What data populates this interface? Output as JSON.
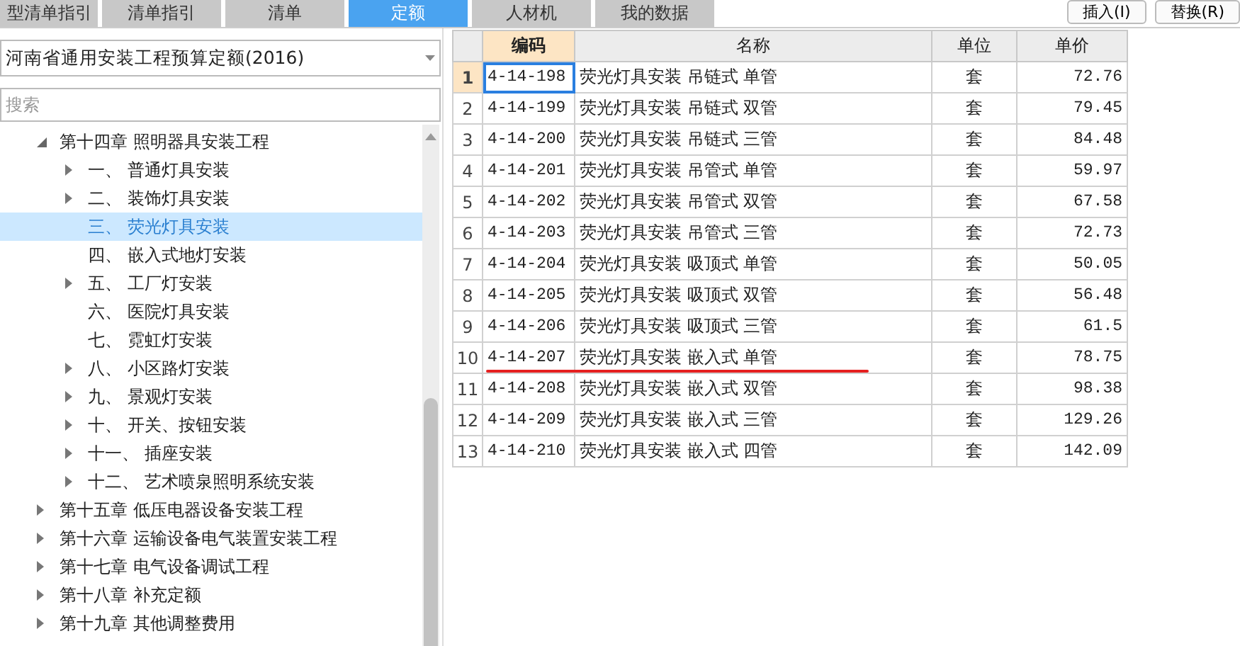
{
  "tabs": [
    {
      "label": "型清单指引",
      "selected": false
    },
    {
      "label": "清单指引",
      "selected": false
    },
    {
      "label": "清单",
      "selected": false
    },
    {
      "label": "定额",
      "selected": true
    },
    {
      "label": "人材机",
      "selected": false
    },
    {
      "label": "我的数据",
      "selected": false
    }
  ],
  "actions": [
    "插入(I)",
    "替换(R)"
  ],
  "library": {
    "value": "河南省通用安装工程预算定额(2016)"
  },
  "search": {
    "placeholder": "搜索"
  },
  "tree": [
    {
      "label": "第十四章 照明器具安装工程",
      "kind": "branch",
      "expanded": true,
      "selected": false,
      "children": [
        {
          "label": "一、 普通灯具安装",
          "kind": "branch",
          "expanded": false,
          "selected": false
        },
        {
          "label": "二、 装饰灯具安装",
          "kind": "branch",
          "expanded": false,
          "selected": false
        },
        {
          "label": "三、 荧光灯具安装",
          "kind": "leaf",
          "expanded": false,
          "selected": true
        },
        {
          "label": "四、 嵌入式地灯安装",
          "kind": "leaf",
          "expanded": false,
          "selected": false
        },
        {
          "label": "五、 工厂灯安装",
          "kind": "branch",
          "expanded": false,
          "selected": false
        },
        {
          "label": "六、 医院灯具安装",
          "kind": "leaf",
          "expanded": false,
          "selected": false
        },
        {
          "label": "七、 霓虹灯安装",
          "kind": "leaf",
          "expanded": false,
          "selected": false
        },
        {
          "label": "八、 小区路灯安装",
          "kind": "branch",
          "expanded": false,
          "selected": false
        },
        {
          "label": "九、 景观灯安装",
          "kind": "branch",
          "expanded": false,
          "selected": false
        },
        {
          "label": "十、 开关、按钮安装",
          "kind": "branch",
          "expanded": false,
          "selected": false
        },
        {
          "label": "十一、 插座安装",
          "kind": "branch",
          "expanded": false,
          "selected": false
        },
        {
          "label": "十二、 艺术喷泉照明系统安装",
          "kind": "branch",
          "expanded": false,
          "selected": false
        }
      ]
    },
    {
      "label": "第十五章 低压电器设备安装工程",
      "kind": "branch",
      "expanded": false,
      "selected": false
    },
    {
      "label": "第十六章 运输设备电气装置安装工程",
      "kind": "branch",
      "expanded": false,
      "selected": false
    },
    {
      "label": "第十七章 电气设备调试工程",
      "kind": "branch",
      "expanded": false,
      "selected": false
    },
    {
      "label": "第十八章 补充定额",
      "kind": "branch",
      "expanded": false,
      "selected": false
    },
    {
      "label": "第十九章 其他调整费用",
      "kind": "branch",
      "expanded": false,
      "selected": false
    }
  ],
  "table": {
    "columns": [
      "编码",
      "名称",
      "单位",
      "单价"
    ],
    "rows": [
      {
        "index": "1",
        "code": "4-14-198",
        "name": "荧光灯具安装 吊链式 单管",
        "unit": "套",
        "price": "72.76",
        "selected": true,
        "underlined": false
      },
      {
        "index": "2",
        "code": "4-14-199",
        "name": "荧光灯具安装 吊链式 双管",
        "unit": "套",
        "price": "79.45",
        "selected": false,
        "underlined": false
      },
      {
        "index": "3",
        "code": "4-14-200",
        "name": "荧光灯具安装 吊链式 三管",
        "unit": "套",
        "price": "84.48",
        "selected": false,
        "underlined": false
      },
      {
        "index": "4",
        "code": "4-14-201",
        "name": "荧光灯具安装 吊管式 单管",
        "unit": "套",
        "price": "59.97",
        "selected": false,
        "underlined": false
      },
      {
        "index": "5",
        "code": "4-14-202",
        "name": "荧光灯具安装 吊管式 双管",
        "unit": "套",
        "price": "67.58",
        "selected": false,
        "underlined": false
      },
      {
        "index": "6",
        "code": "4-14-203",
        "name": "荧光灯具安装 吊管式 三管",
        "unit": "套",
        "price": "72.73",
        "selected": false,
        "underlined": false
      },
      {
        "index": "7",
        "code": "4-14-204",
        "name": "荧光灯具安装 吸顶式 单管",
        "unit": "套",
        "price": "50.05",
        "selected": false,
        "underlined": false
      },
      {
        "index": "8",
        "code": "4-14-205",
        "name": "荧光灯具安装 吸顶式 双管",
        "unit": "套",
        "price": "56.48",
        "selected": false,
        "underlined": false
      },
      {
        "index": "9",
        "code": "4-14-206",
        "name": "荧光灯具安装 吸顶式 三管",
        "unit": "套",
        "price": "61.5",
        "selected": false,
        "underlined": false
      },
      {
        "index": "10",
        "code": "4-14-207",
        "name": "荧光灯具安装 嵌入式 单管",
        "unit": "套",
        "price": "78.75",
        "selected": false,
        "underlined": true
      },
      {
        "index": "11",
        "code": "4-14-208",
        "name": "荧光灯具安装 嵌入式 双管",
        "unit": "套",
        "price": "98.38",
        "selected": false,
        "underlined": false
      },
      {
        "index": "12",
        "code": "4-14-209",
        "name": "荧光灯具安装 嵌入式 三管",
        "unit": "套",
        "price": "129.26",
        "selected": false,
        "underlined": false
      },
      {
        "index": "13",
        "code": "4-14-210",
        "name": "荧光灯具安装 嵌入式 四管",
        "unit": "套",
        "price": "142.09",
        "selected": false,
        "underlined": false
      }
    ]
  }
}
